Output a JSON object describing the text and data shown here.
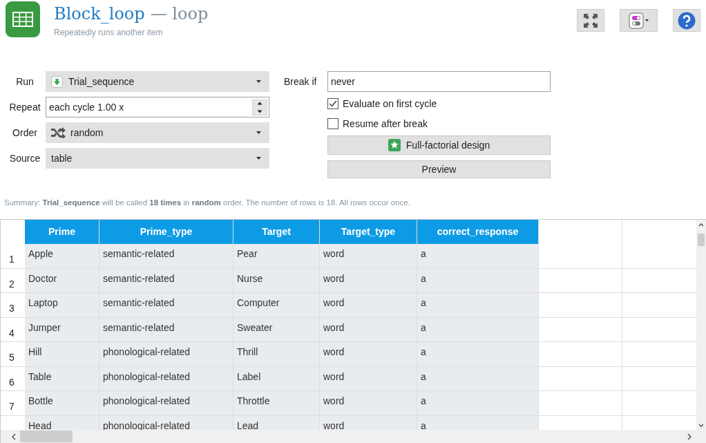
{
  "header": {
    "title": "Block_loop",
    "type": "— loop",
    "subtitle": "Repeatedly runs another item"
  },
  "form": {
    "fields": [
      {
        "label": "Run",
        "kind": "sequence",
        "value": "Trial_sequence"
      },
      {
        "label": "Repeat",
        "kind": "spinbox",
        "value": "each cycle 1.00 x"
      },
      {
        "label": "Order",
        "kind": "shuffle",
        "value": "random"
      },
      {
        "label": "Source",
        "kind": "combo",
        "value": "table"
      }
    ],
    "break_if": {
      "label": "Break if",
      "value": "never"
    },
    "checkboxes": [
      {
        "label": "Evaluate on first cycle",
        "checked": true
      },
      {
        "label": "Resume after break",
        "checked": false
      }
    ],
    "buttons": [
      {
        "label": "Full-factorial design",
        "kind": "factorial"
      },
      {
        "label": "Preview",
        "kind": "plain"
      }
    ]
  },
  "summary": "Summary: **Trial_sequence** will be called **18 times** in **random** order. The number of rows is 18. All rows occur once.",
  "table": {
    "columns": [
      "Prime",
      "Prime_type",
      "Target",
      "Target_type",
      "correct_response"
    ],
    "rows": [
      {
        "number": "1",
        "cells": [
          "Apple",
          "semantic-related",
          "Pear",
          "word",
          "a"
        ]
      },
      {
        "number": "2",
        "cells": [
          "Doctor",
          "semantic-related",
          "Nurse",
          "word",
          "a"
        ]
      },
      {
        "number": "3",
        "cells": [
          "Laptop",
          "semantic-related",
          "Computer",
          "word",
          "a"
        ]
      },
      {
        "number": "4",
        "cells": [
          "Jumper",
          "semantic-related",
          "Sweater",
          "word",
          "a"
        ]
      },
      {
        "number": "5",
        "cells": [
          "Hill",
          "phonological-related",
          "Thrill",
          "word",
          "a"
        ]
      },
      {
        "number": "6",
        "cells": [
          "Table",
          "phonological-related",
          "Label",
          "word",
          "a"
        ]
      },
      {
        "number": "7",
        "cells": [
          "Bottle",
          "phonological-related",
          "Throttle",
          "word",
          "a"
        ]
      },
      {
        "cells": [
          "Head",
          "phonological-related",
          "Lead",
          "word",
          "a"
        ]
      }
    ]
  }
}
